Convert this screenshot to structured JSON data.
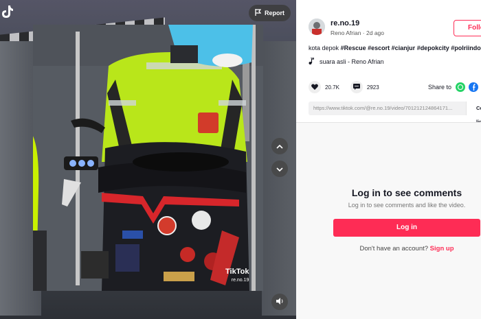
{
  "video": {
    "report_label": "Report",
    "watermark_brand": "TikTok",
    "watermark_user": "re.no.19",
    "icons": {
      "close": "tiktok-logo-icon",
      "report": "flag-icon",
      "prev": "chevron-up-icon",
      "next": "chevron-down-icon",
      "volume": "volume-icon"
    }
  },
  "author": {
    "username": "re.no.19",
    "display_name": "Reno Afrian",
    "posted": "2d ago",
    "follow_label": "Follow"
  },
  "caption": {
    "text": "kota depok",
    "hashtags": [
      "#Rescue",
      "#escort",
      "#cianjur",
      "#depokcity",
      "#polriindo"
    ]
  },
  "sound": {
    "label": "suara asli - Reno Afrian"
  },
  "stats": {
    "likes": "20.7K",
    "comments": "2923"
  },
  "share": {
    "label": "Share to",
    "colors": {
      "whatsapp": "#25d366",
      "facebook": "#1877f2"
    }
  },
  "link": {
    "url": "https://www.tiktok.com/@re.no.19/video/701212124864171...",
    "copy_label": "Copy link"
  },
  "comments": {
    "title": "Log in to see comments",
    "subtitle": "Log in to see comments and like the video.",
    "login_label": "Log in",
    "no_account": "Don't have an account?",
    "signup_label": "Sign up"
  },
  "colors": {
    "accent": "#fe2c55",
    "text": "#161823"
  }
}
